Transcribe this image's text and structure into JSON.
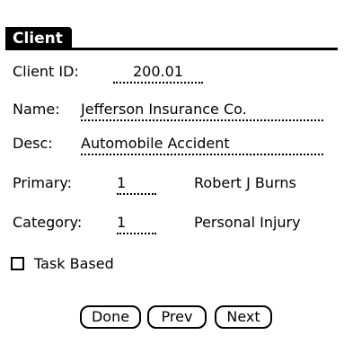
{
  "form": {
    "title": "Client",
    "client_id": {
      "label": "Client ID:",
      "value": "200.01"
    },
    "name": {
      "label": "Name:",
      "value": "Jefferson Insurance Co."
    },
    "desc": {
      "label": "Desc:",
      "value": "Automobile Accident"
    },
    "primary": {
      "label": "Primary:",
      "value": "1",
      "resolved": "Robert J Burns"
    },
    "category": {
      "label": "Category:",
      "value": "1",
      "resolved": "Personal Injury"
    },
    "task_based": {
      "label": "Task Based",
      "checked": false
    }
  },
  "buttons": {
    "done": "Done",
    "prev": "Prev",
    "next": "Next"
  }
}
